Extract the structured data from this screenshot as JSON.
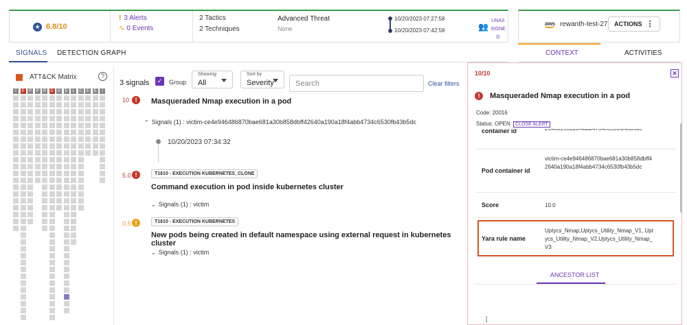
{
  "summary": {
    "score": "6.8/10",
    "alerts": "3 Alerts",
    "events": "0 Events",
    "tactics": "2 Tactics",
    "techniques": "2 Techniques",
    "threat_title": "Advanced Threat",
    "threat_sub": "None",
    "time_start": "10/20/2023 07:27:58",
    "time_end": "10/20/2023 07:42:58",
    "assignee": "UNASSIGNED"
  },
  "host": {
    "cloud": "aws",
    "name": "rewanth-test-27",
    "actions_label": "ACTIONS"
  },
  "tabs": {
    "signals": "SIGNALS",
    "detection_graph": "DETECTION GRAPH",
    "context": "CONTEXT",
    "activities": "ACTIVITIES"
  },
  "matrix": {
    "title": "ATT&CK Matrix",
    "help": "?",
    "columns": [
      {
        "h": "I",
        "n": 20
      },
      {
        "h": "E",
        "n": 33
      },
      {
        "h": "P",
        "n": 19
      },
      {
        "h": "P",
        "n": 13
      },
      {
        "h": "R",
        "n": 20
      },
      {
        "h": "D",
        "n": 34
      },
      {
        "h": "C",
        "n": 17
      },
      {
        "h": "D",
        "n": 32
      },
      {
        "h": "L",
        "n": 22
      },
      {
        "h": "C",
        "n": 17
      },
      {
        "h": "E",
        "n": 9
      },
      {
        "h": "E",
        "n": 9
      },
      {
        "h": "I",
        "n": 13
      }
    ]
  },
  "toolbar": {
    "count": "3 signals",
    "group_label": "Group",
    "showing_label": "Showing",
    "showing_value": "All",
    "sort_label": "Sort by",
    "sort_value": "Severity",
    "search_placeholder": "Search",
    "clear_filters": "Clear filters"
  },
  "signals": [
    {
      "score": "10",
      "title": "Masqueraded Nmap execution in a pod",
      "sub": "Signals (1) : victim-ce4e946486870bae681a30b858dbff42640a190a18f4abb4734c6530fb43b5dc",
      "time": "10/20/2023 07:34:32",
      "color": "#c0392b"
    },
    {
      "score": "5.0",
      "tag": "T1610 - EXECUTION KUBERNETES_CLONE",
      "title": "Command execution in pod inside kubernetes cluster",
      "sub": "Signals (1) : victim",
      "color": "#c0392b"
    },
    {
      "score": "0.5",
      "tag": "T1610 - EXECUTION KUBERNETES",
      "title": "New pods being created in default namespace using external request in kubernetes cluster",
      "sub": "Signals (1) : victim",
      "color": "#e8a21a"
    }
  ],
  "context": {
    "ratio": "10/10",
    "title": "Masqueraded Nmap execution in a pod",
    "code": "Code: 20016",
    "status": "Status: OPEN",
    "close_alert": "CLOSE ALERT",
    "rows": [
      {
        "k": "container id",
        "v": "2640a190a18f4abb4734c6530fb43b5dc"
      },
      {
        "k": "Pod container id",
        "v": "victim-ce4e946486870bae681a30b858dbff42640a190a18f4abb4734c6530fb43b5dc"
      },
      {
        "k": "Score",
        "v": "10.0"
      },
      {
        "k": "Yara rule name",
        "v": "Uptycs_Nmap,Uptycs_Utility_Nmap_V1, Uptycs_Utility_Nmap_V2,Uptycs_Utility_Nmap_V3"
      }
    ],
    "ancestor_list": "ANCESTOR LIST",
    "bracket": "["
  }
}
